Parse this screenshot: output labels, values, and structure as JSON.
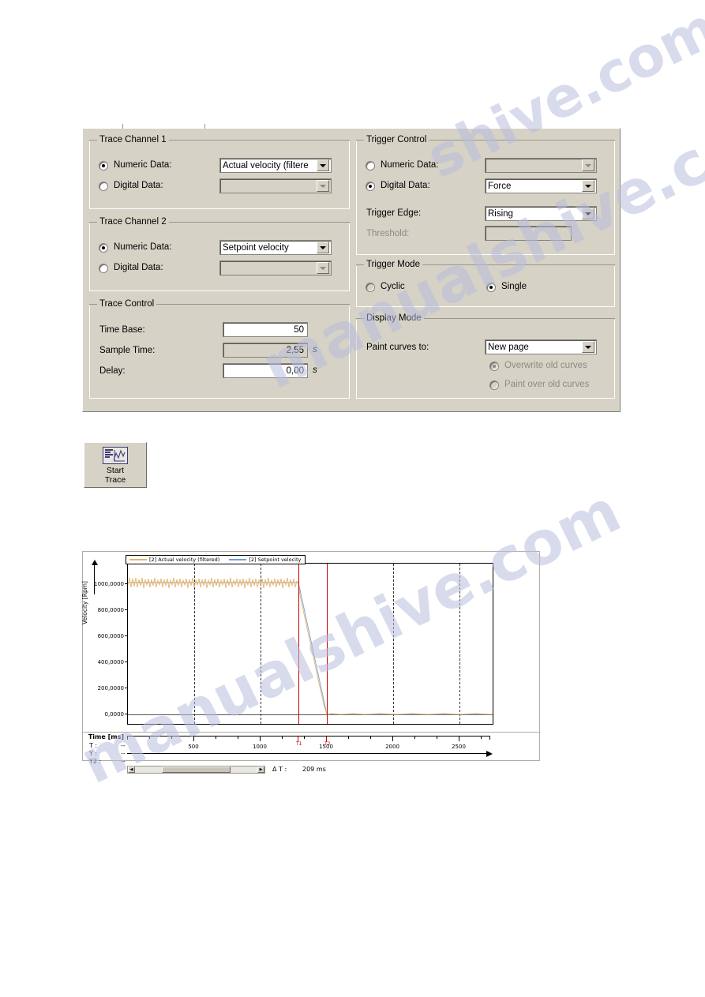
{
  "dialog": {
    "trace_channel_1": {
      "title": "Trace Channel 1",
      "numeric_label": "Numeric Data:",
      "numeric_value": "Actual velocity (filtere",
      "numeric_selected": true,
      "digital_label": "Digital Data:",
      "digital_value": "",
      "digital_selected": false
    },
    "trace_channel_2": {
      "title": "Trace Channel 2",
      "numeric_label": "Numeric Data:",
      "numeric_value": "Setpoint velocity",
      "numeric_selected": true,
      "digital_label": "Digital Data:",
      "digital_value": "",
      "digital_selected": false
    },
    "trace_control": {
      "title": "Trace Control",
      "time_base_label": "Time Base:",
      "time_base_value": "50",
      "sample_time_label": "Sample Time:",
      "sample_time_value": "2,55",
      "sample_time_unit": "s",
      "delay_label": "Delay:",
      "delay_value": "0,00",
      "delay_unit": "s"
    },
    "trigger_control": {
      "title": "Trigger Control",
      "numeric_label": "Numeric Data:",
      "numeric_value": "",
      "numeric_selected": false,
      "digital_label": "Digital Data:",
      "digital_value": "Force",
      "digital_selected": true,
      "trigger_edge_label": "Trigger Edge:",
      "trigger_edge_value": "Rising",
      "threshold_label": "Threshold:",
      "threshold_value": ""
    },
    "trigger_mode": {
      "title": "Trigger Mode",
      "cyclic_label": "Cyclic",
      "cyclic_selected": false,
      "single_label": "Single",
      "single_selected": true
    },
    "display_mode": {
      "title": "Display Mode",
      "paint_curves_label": "Paint curves to:",
      "paint_curves_value": "New page",
      "overwrite_label": "Overwrite old curves",
      "overwrite_selected": true,
      "paint_over_label": "Paint over old curves",
      "paint_over_selected": false
    }
  },
  "toolbar": {
    "start_trace_line1": "Start",
    "start_trace_line2": "Trace",
    "start_trace_icon": "trace-chart-icon"
  },
  "chart_data": {
    "type": "line",
    "title": "",
    "xlabel": "Time [ms]",
    "ylabel": "Velocity [Rpm]",
    "xlim": [
      0,
      2750
    ],
    "ylim": [
      -100,
      1150
    ],
    "xticks": [
      500,
      1000,
      1500,
      2000,
      2500
    ],
    "ytick_labels": [
      "1000,0000",
      "800,0000",
      "600,0000",
      "400,0000",
      "200,0000",
      "0,0000"
    ],
    "ytick_values": [
      1000,
      800,
      600,
      400,
      200,
      0
    ],
    "grid": "vertical-dashed",
    "legend_position": "top-left",
    "series": [
      {
        "name": "[2] Actual velocity (filtered)",
        "color": "#e8b464",
        "description": "Oscillates around 1000 Rpm until ~1290 ms, ramps down linearly to 0 Rpm at ~1500 ms, then stays near 0",
        "points": [
          [
            0,
            1010
          ],
          [
            100,
            1005
          ],
          [
            200,
            1015
          ],
          [
            300,
            1000
          ],
          [
            400,
            1012
          ],
          [
            500,
            1005
          ],
          [
            600,
            1010
          ],
          [
            700,
            1002
          ],
          [
            800,
            1010
          ],
          [
            900,
            1005
          ],
          [
            1000,
            1012
          ],
          [
            1100,
            1004
          ],
          [
            1200,
            1010
          ],
          [
            1290,
            1000
          ],
          [
            1350,
            720
          ],
          [
            1420,
            380
          ],
          [
            1500,
            10
          ],
          [
            1700,
            5
          ],
          [
            2000,
            3
          ],
          [
            2300,
            6
          ],
          [
            2600,
            2
          ],
          [
            2750,
            3
          ]
        ]
      },
      {
        "name": "[2] Setpoint velocity",
        "color": "#6f9fd8",
        "description": "Constant 1000 Rpm until ~1290 ms, linear ramp down to 0 at ~1500 ms, then 0",
        "points": [
          [
            0,
            1000
          ],
          [
            1290,
            1000
          ],
          [
            1500,
            0
          ],
          [
            2750,
            0
          ]
        ]
      }
    ],
    "cursors": [
      {
        "name": "T1",
        "x": 1290,
        "color": "#cc0000"
      },
      {
        "name": "T2",
        "x": 1500,
        "color": "#cc0000"
      }
    ],
    "readouts": [
      {
        "label": "T :",
        "value": "--"
      },
      {
        "label": "Y :",
        "value": "--"
      },
      {
        "label": "Y2 :",
        "value": "--"
      }
    ],
    "delta_label": "Δ T :",
    "delta_value": "209 ms"
  },
  "watermark": {
    "line1": "manualshive.com",
    "line2": "manualshive.com",
    "line3": "shive.com"
  },
  "colors": {
    "dialog_bg": "#d6d2c6",
    "cursor_red": "#cc0000",
    "series1": "#e8b464",
    "series2": "#6f9fd8"
  }
}
